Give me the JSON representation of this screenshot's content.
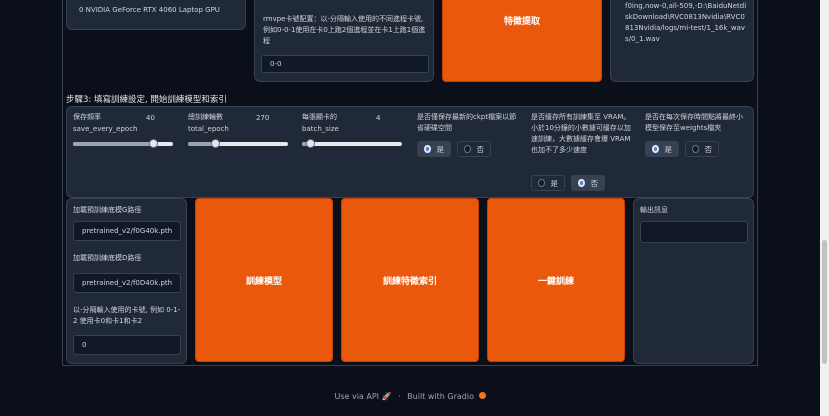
{
  "top": {
    "gpu_info": "0  NVIDIA GeForce RTX 4060 Laptop GPU",
    "gpu_desc": "rmvpe卡號配置：以-分隔輸入使用的不同進程卡號,例如0-0-1使用在卡0上跑2個進程並在卡1上跑1個進程",
    "gpu_value": "0-0",
    "orange_label": "特徵提取",
    "log_text": "f0ing,now-0,all-509,-D:\\BaiduNetdiskDownload\\RVC0813Nvidia\\RVC0813Nvidia/logs/mi-test/1_16k_wavs/0_1.wav"
  },
  "step3_title": "步驟3: 填寫訓練設定, 開始訓練模型和索引",
  "settings": {
    "save_every": {
      "label_zh": "保存頻率",
      "label_en": "save_every_epoch",
      "value": "40",
      "fraction": 0.8
    },
    "total_epoch": {
      "label_zh": "總訓練輪數",
      "label_en": "total_epoch",
      "value": "270",
      "fraction": 0.27
    },
    "batch_size": {
      "label_zh": "每張顯卡的",
      "label_en": "batch_size",
      "value": "4",
      "fraction": 0.08
    },
    "save_latest": {
      "label": "是否僅保存最新的ckpt檔案以節省硬碟空間",
      "yes": "是",
      "no": "否",
      "selected": "yes"
    },
    "cache_gpu": {
      "label": "是否緩存所有訓練集至 VRAM。小於10分鐘的小數據可緩存以加速訓練，大數據緩存會爆 VRAM 也加不了多少速度",
      "yes": "是",
      "no": "否",
      "selected": "no"
    },
    "save_weights": {
      "label": "是否在每次保存時間點將最終小模型保存至weights檔夾",
      "yes": "是",
      "no": "否",
      "selected": "yes"
    }
  },
  "pretrain": {
    "g_label": "加載預訓練底模G路徑",
    "g_value": "pretrained_v2/f0G40k.pth",
    "d_label": "加載預訓練底模D路徑",
    "d_value": "pretrained_v2/f0D40k.pth",
    "gpu_label": "以-分隔輸入使用的卡號, 例如 0-1-2 使用卡0和卡1和卡2",
    "gpu_value": "0"
  },
  "buttons": {
    "train_model": "訓練模型",
    "train_index": "訓練特徵索引",
    "one_click": "一鍵訓練"
  },
  "output": {
    "label": "輸出訊息"
  },
  "footer": {
    "api": "Use via API",
    "sep": "·",
    "built": "Built with Gradio"
  }
}
